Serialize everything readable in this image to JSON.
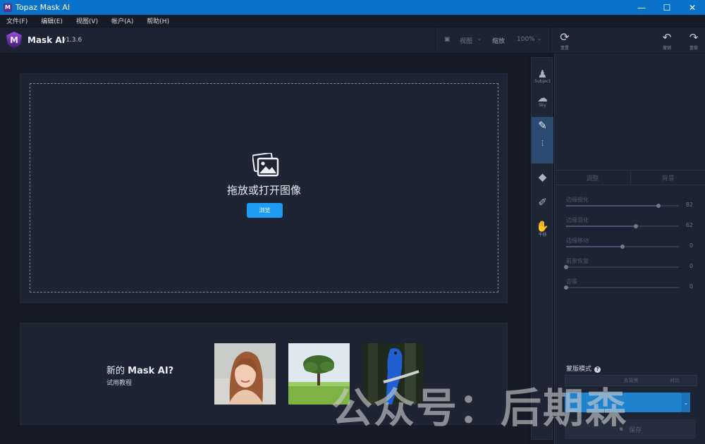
{
  "window": {
    "title": "Topaz Mask AI",
    "minimize": "—",
    "maximize": "☐",
    "close": "✕"
  },
  "menu": [
    "文件(F)",
    "编辑(E)",
    "视图(V)",
    "帐户(A)",
    "帮助(H)"
  ],
  "app": {
    "name": "Mask AI",
    "version": "v1.3.6"
  },
  "toolbar": {
    "view_label": "视图",
    "zoom_label": "缩放",
    "zoom_value": "100%",
    "reset_label": "重置",
    "undo_label": "撤销",
    "redo_label": "重做"
  },
  "dropzone": {
    "text": "拖放或打开图像",
    "browse_label": "浏览"
  },
  "tutorial": {
    "title_prefix": "新的 ",
    "title_bold": "Mask AI?",
    "subtitle": "试用教程"
  },
  "tools": [
    {
      "icon": "subject-icon",
      "label": "Subject"
    },
    {
      "icon": "sky-icon",
      "label": "Sky"
    },
    {
      "icon": "brush-icon",
      "label": ""
    },
    {
      "icon": "fill-icon",
      "label": ""
    },
    {
      "icon": "eyedropper-icon",
      "label": ""
    },
    {
      "icon": "hand-icon",
      "label": "平移"
    }
  ],
  "panel": {
    "tabs": [
      "调整",
      "背景"
    ],
    "sliders": [
      {
        "name": "边缘锐化",
        "value": "82",
        "level": 0.82
      },
      {
        "name": "边缘羽化",
        "value": "62",
        "level": 0.62
      },
      {
        "name": "边缘移动",
        "value": "0",
        "level": 0.5
      },
      {
        "name": "前景恢复",
        "value": "0",
        "level": 0.0
      },
      {
        "name": "去噪",
        "value": "0",
        "level": 0.0
      }
    ],
    "mask_mode_label": "蒙版模式",
    "mask_mode_options": [
      "",
      "去背景",
      "对比"
    ],
    "save_label": "保存"
  },
  "watermark": "公众号：后期森",
  "colors": {
    "accent": "#1e9bf2",
    "titlebar": "#0a72c9",
    "background": "#141a26",
    "card": "#1d2535"
  }
}
